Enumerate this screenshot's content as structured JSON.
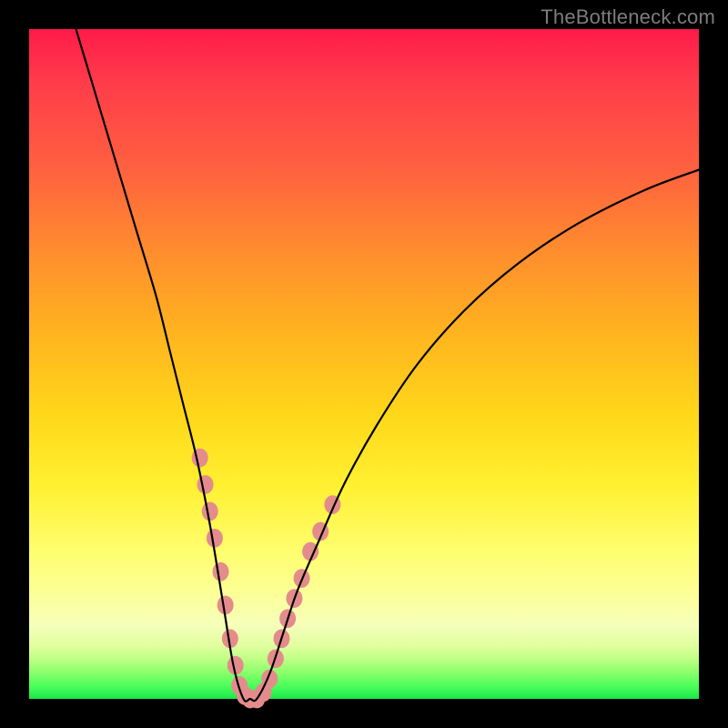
{
  "watermark": "TheBottleneck.com",
  "chart_data": {
    "type": "line",
    "title": "",
    "xlabel": "",
    "ylabel": "",
    "xlim": [
      0,
      100
    ],
    "ylim": [
      0,
      100
    ],
    "grid": false,
    "series": [
      {
        "name": "bottleneck-curve",
        "color": "#000000",
        "x": [
          7,
          10,
          13,
          16,
          19,
          21,
          23,
          25,
          27,
          29,
          30.5,
          32,
          33,
          34,
          36,
          38,
          40,
          43,
          47,
          52,
          58,
          65,
          73,
          82,
          92,
          100
        ],
        "y": [
          100,
          90,
          80,
          70,
          60,
          52,
          44,
          36,
          26,
          14,
          5,
          0,
          0,
          0,
          4,
          10,
          16,
          23,
          32,
          41,
          50,
          58,
          65,
          71,
          76,
          79
        ]
      }
    ],
    "markers": [
      {
        "name": "highlight-dots",
        "shape": "circle",
        "color": "#e48c8c",
        "radius_px": 9,
        "points": [
          {
            "x": 25.5,
            "y": 36
          },
          {
            "x": 26.3,
            "y": 32
          },
          {
            "x": 27.0,
            "y": 28
          },
          {
            "x": 27.7,
            "y": 24
          },
          {
            "x": 28.6,
            "y": 19
          },
          {
            "x": 29.3,
            "y": 14
          },
          {
            "x": 30.0,
            "y": 9
          },
          {
            "x": 30.8,
            "y": 5
          },
          {
            "x": 31.4,
            "y": 2
          },
          {
            "x": 32.2,
            "y": 0.5
          },
          {
            "x": 33.0,
            "y": 0
          },
          {
            "x": 34.0,
            "y": 0
          },
          {
            "x": 35.0,
            "y": 1
          },
          {
            "x": 35.9,
            "y": 3
          },
          {
            "x": 36.8,
            "y": 6
          },
          {
            "x": 37.7,
            "y": 9
          },
          {
            "x": 38.6,
            "y": 12
          },
          {
            "x": 39.6,
            "y": 15
          },
          {
            "x": 40.7,
            "y": 18
          },
          {
            "x": 42.0,
            "y": 22
          },
          {
            "x": 43.5,
            "y": 25
          },
          {
            "x": 45.3,
            "y": 29
          }
        ]
      }
    ]
  }
}
